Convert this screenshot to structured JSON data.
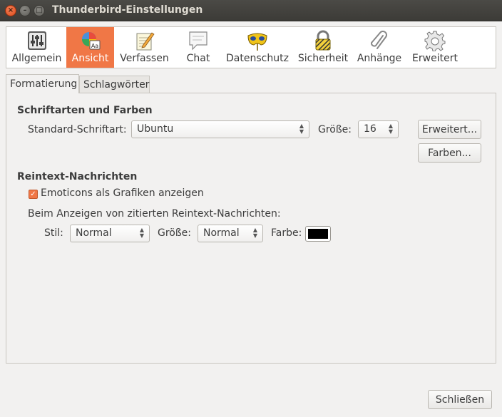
{
  "window": {
    "title": "Thunderbird-Einstellungen"
  },
  "window_buttons": {
    "close": "×",
    "minimize": "–",
    "maximize": "□"
  },
  "panes": [
    {
      "label": "Allgemein",
      "icon": "sliders-icon"
    },
    {
      "label": "Ansicht",
      "icon": "palette-icon",
      "selected": true
    },
    {
      "label": "Verfassen",
      "icon": "notepad-pencil-icon"
    },
    {
      "label": "Chat",
      "icon": "speech-bubble-icon"
    },
    {
      "label": "Datenschutz",
      "icon": "mask-icon"
    },
    {
      "label": "Sicherheit",
      "icon": "padlock-icon"
    },
    {
      "label": "Anhänge",
      "icon": "paperclip-icon"
    },
    {
      "label": "Erweitert",
      "icon": "gear-icon"
    }
  ],
  "tabs": {
    "formatting": "Formatierung",
    "tags": "Schlagwörter"
  },
  "fonts_colors": {
    "heading": "Schriftarten und Farben",
    "default_font_label": "Standard-Schriftart:",
    "default_font_value": "Ubuntu",
    "size_label": "Größe:",
    "size_value": "16",
    "advanced_button": "Erweitert...",
    "colors_button": "Farben..."
  },
  "plaintext": {
    "heading": "Reintext-Nachrichten",
    "emoticons_label": "Emoticons als Grafiken anzeigen",
    "emoticons_checked": true,
    "quoted_label": "Beim Anzeigen von zitierten Reintext-Nachrichten:",
    "style_label": "Stil:",
    "style_value": "Normal",
    "size_label": "Größe:",
    "size_value": "Normal",
    "color_label": "Farbe:",
    "color_value": "#000000"
  },
  "footer": {
    "close_button": "Schließen"
  },
  "colors": {
    "accent": "#f07746",
    "titlebar": "#3c3b37"
  }
}
